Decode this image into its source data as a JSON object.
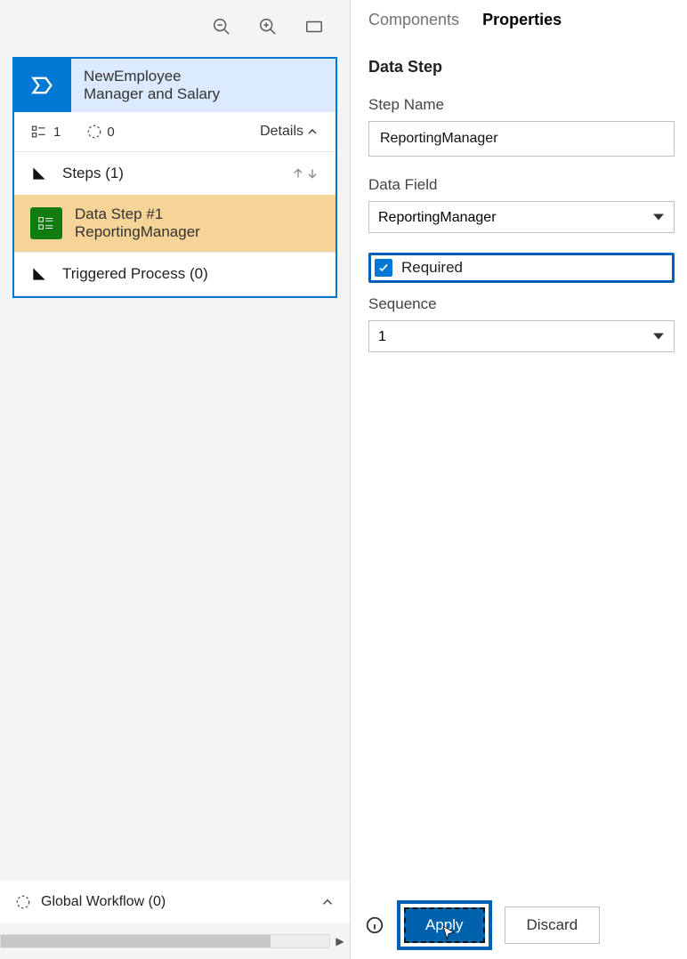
{
  "toolbar": {
    "zoom_out": "zoom-out",
    "zoom_in": "zoom-in",
    "fit": "fit-screen"
  },
  "stage": {
    "title_line1": "NewEmployee",
    "title_line2": "Manager and Salary",
    "count1": "1",
    "count2": "0",
    "details_label": "Details",
    "steps_label": "Steps (1)",
    "data_step_title": "Data Step #1",
    "data_step_name": "ReportingManager",
    "triggered_label": "Triggered Process (0)"
  },
  "global_workflow": {
    "label": "Global Workflow (0)"
  },
  "panel": {
    "tab_components": "Components",
    "tab_properties": "Properties",
    "section_title": "Data Step",
    "step_name_label": "Step Name",
    "step_name_value": "ReportingManager",
    "data_field_label": "Data Field",
    "data_field_value": "ReportingManager",
    "required_label": "Required",
    "sequence_label": "Sequence",
    "sequence_value": "1",
    "apply_label": "Apply",
    "discard_label": "Discard"
  }
}
